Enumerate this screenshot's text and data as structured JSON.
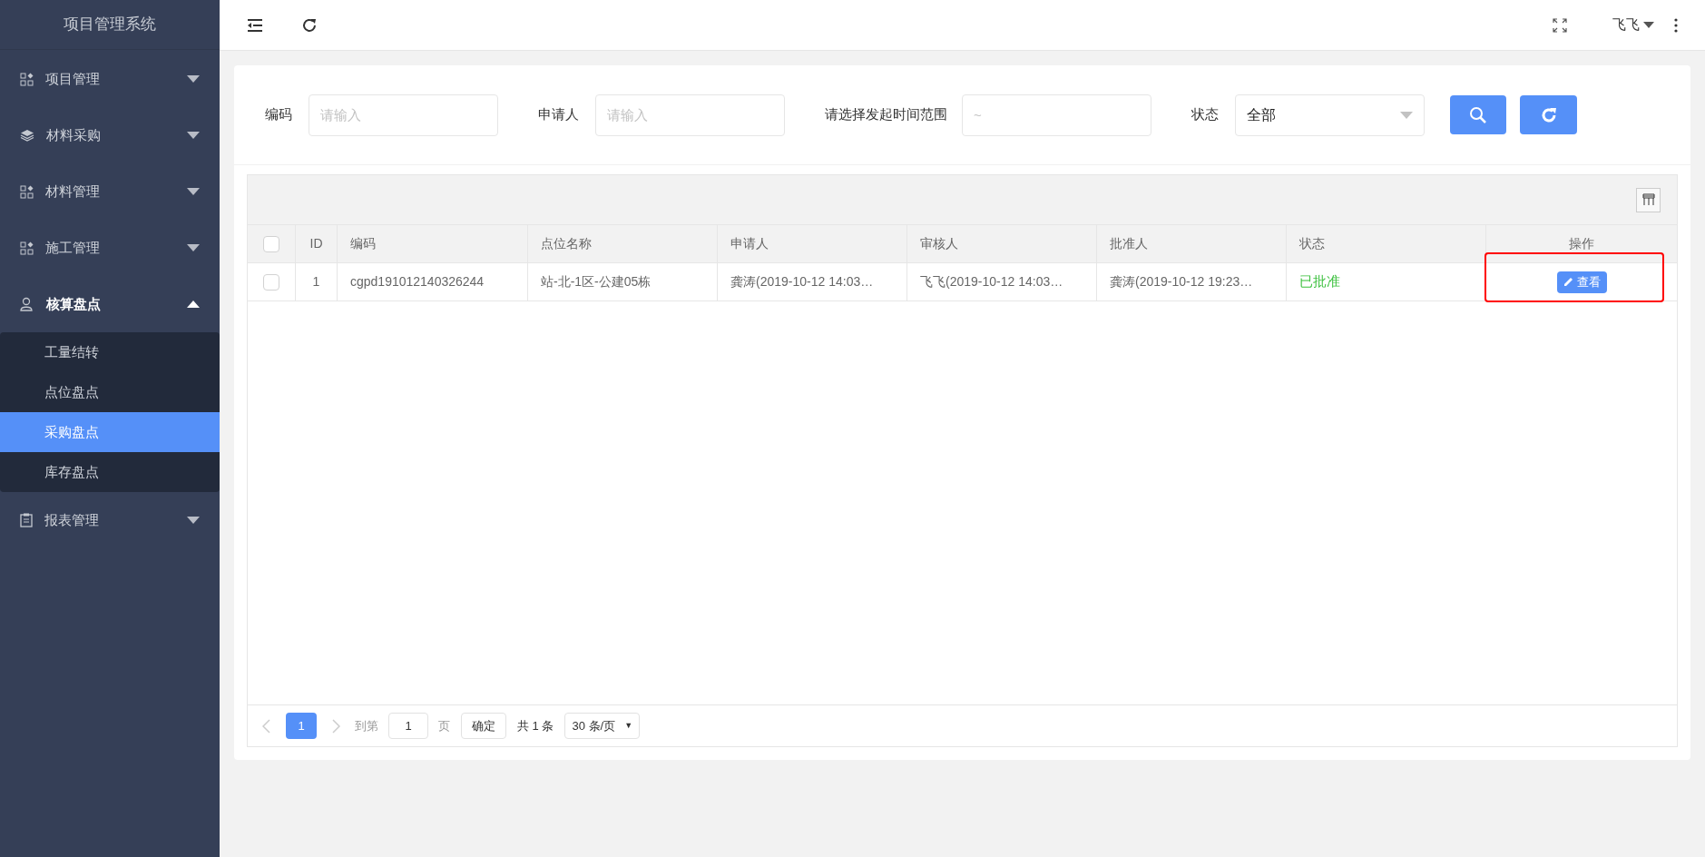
{
  "sidebar": {
    "title": "项目管理系统",
    "items": [
      {
        "label": "项目管理",
        "kind": "grid",
        "expanded": false
      },
      {
        "label": "材料采购",
        "kind": "layers",
        "expanded": false
      },
      {
        "label": "材料管理",
        "kind": "grid",
        "expanded": false
      },
      {
        "label": "施工管理",
        "kind": "grid",
        "expanded": false
      },
      {
        "label": "核算盘点",
        "kind": "user",
        "expanded": true,
        "children": [
          {
            "label": "工量结转",
            "selected": false
          },
          {
            "label": "点位盘点",
            "selected": false
          },
          {
            "label": "采购盘点",
            "selected": true
          },
          {
            "label": "库存盘点",
            "selected": false
          }
        ]
      },
      {
        "label": "报表管理",
        "kind": "clipboard",
        "expanded": false
      }
    ]
  },
  "header": {
    "user": "飞飞"
  },
  "filters": {
    "code": {
      "label": "编码",
      "placeholder": "请输入"
    },
    "applicant": {
      "label": "申请人",
      "placeholder": "请输入"
    },
    "date_range": {
      "label": "请选择发起时间范围",
      "placeholder": "~"
    },
    "status": {
      "label": "状态",
      "value": "全部"
    }
  },
  "table": {
    "columns": [
      "ID",
      "编码",
      "点位名称",
      "申请人",
      "审核人",
      "批准人",
      "状态",
      "操作"
    ],
    "header_checked": false,
    "rows": [
      {
        "checked": false,
        "id": "1",
        "code": "cgpd191012140326244",
        "site": "站-北-1区-公建05栋",
        "applicant": "龚涛(2019-10-12 14:03…",
        "reviewer": "飞飞(2019-10-12 14:03…",
        "approver": "龚涛(2019-10-12 19:23…",
        "status": "已批准",
        "action": "查看",
        "highlighted": true
      }
    ]
  },
  "pagination": {
    "pages": [
      {
        "label": "1",
        "selected": true
      }
    ],
    "goto_label": "到第",
    "goto_value": "1",
    "page_unit": "页",
    "confirm": "确定",
    "total": "共 1 条",
    "page_size": "30 条/页",
    "page_size_caret": "▼"
  }
}
